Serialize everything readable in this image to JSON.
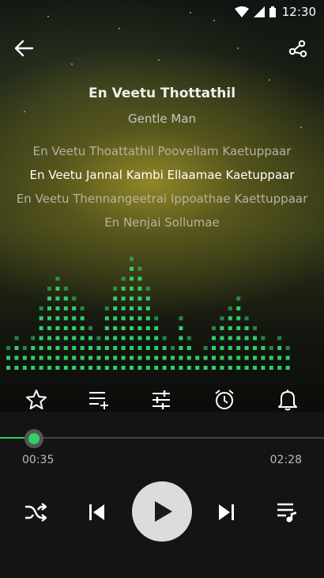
{
  "status_bar": {
    "time": "12:30",
    "icons": [
      "wifi-icon",
      "cellular-signal-icon",
      "battery-icon"
    ]
  },
  "header": {
    "back_icon": "arrow-left-icon",
    "share_icon": "share-icon"
  },
  "song": {
    "title": "En Veetu Thottathil",
    "artist": "Gentle Man"
  },
  "lyrics": {
    "lines": [
      {
        "text": "En Veetu Thoattathil Poovellam Kaetuppaar",
        "active": false
      },
      {
        "text": "En Veetu Jannal Kambi Ellaamae Kaetuppaar",
        "active": true
      },
      {
        "text": "En Veetu Thennangeetrai Ippoathae Kaettuppaar",
        "active": false
      },
      {
        "text": "En Nenjai Sollumae",
        "active": false
      }
    ]
  },
  "equalizer": {
    "color": "#2fcf6a",
    "levels": [
      3,
      4,
      3,
      4,
      7,
      9,
      10,
      9,
      8,
      7,
      5,
      4,
      7,
      9,
      10,
      12,
      11,
      9,
      6,
      4,
      3,
      6,
      4,
      2,
      3,
      5,
      6,
      7,
      8,
      6,
      5,
      4,
      3,
      4,
      3
    ]
  },
  "actions": [
    "favorite-star-icon",
    "add-to-playlist-icon",
    "equalizer-settings-icon",
    "sleep-timer-alarm-icon",
    "notification-bell-icon"
  ],
  "player": {
    "progress": 0.104,
    "current_time": "00:35",
    "duration": "02:28",
    "accent": "#2fcf6a",
    "controls": [
      "shuffle-icon",
      "previous-icon",
      "play-icon",
      "next-icon",
      "queue-icon"
    ]
  }
}
